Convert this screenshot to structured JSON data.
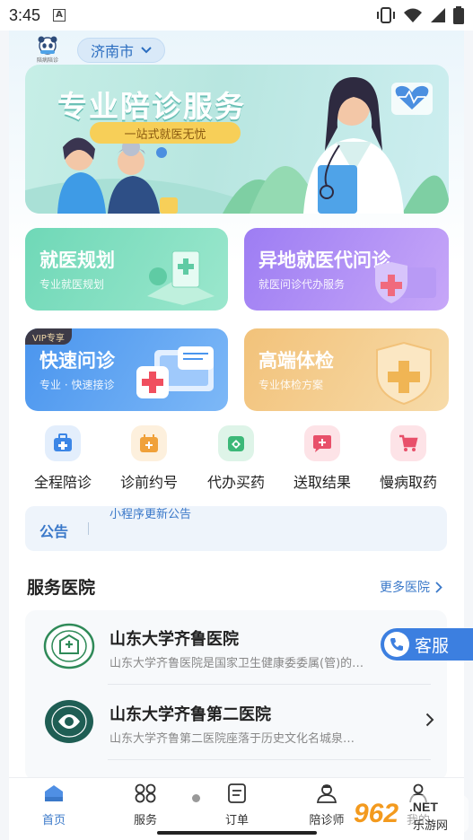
{
  "status_bar": {
    "time": "3:45",
    "a_badge": "A"
  },
  "header": {
    "logo_text": "陪病陪诊",
    "city": "济南市"
  },
  "banner": {
    "title": "专业陪诊服务",
    "subtitle": "一站式就医无忧"
  },
  "cards": [
    {
      "title": "就医规划",
      "subtitle": "专业就医规划"
    },
    {
      "title": "异地就医代问诊",
      "subtitle": "就医问诊代办服务"
    },
    {
      "title": "快速问诊",
      "subtitle": "专业 · 快速接诊",
      "badge": "VIP专享"
    },
    {
      "title": "高端体检",
      "subtitle": "专业体检方案"
    }
  ],
  "quick_actions": [
    {
      "label": "全程陪诊",
      "icon": "medical-kit-icon",
      "color": "#3c86e6"
    },
    {
      "label": "诊前约号",
      "icon": "calendar-plus-icon",
      "color": "#f0a13a"
    },
    {
      "label": "代办买药",
      "icon": "medicine-icon",
      "color": "#3cb878"
    },
    {
      "label": "送取结果",
      "icon": "report-icon",
      "color": "#e8506a"
    },
    {
      "label": "慢病取药",
      "icon": "cart-icon",
      "color": "#e8506a"
    }
  ],
  "notice": {
    "label": "公告",
    "text": "小程序更新公告"
  },
  "section": {
    "title": "服务医院",
    "more": "更多医院"
  },
  "hospitals": [
    {
      "name": "山东大学齐鲁医院",
      "desc": "山东大学齐鲁医院是国家卫生健康委委属(管)的…"
    },
    {
      "name": "山东大学齐鲁第二医院",
      "desc": "山东大学齐鲁第二医院座落于历史文化名城泉…"
    }
  ],
  "float_service": {
    "label": "客服"
  },
  "tabs": [
    {
      "label": "首页",
      "icon": "home-icon"
    },
    {
      "label": "服务",
      "icon": "grid-icon"
    },
    {
      "label": "订单",
      "icon": "order-icon"
    },
    {
      "label": "陪诊师",
      "icon": "nurse-icon"
    },
    {
      "label": "我的",
      "icon": "profile-icon"
    }
  ],
  "watermark": {
    "brand": "962",
    "suffix": ".NET",
    "caption": "乐游网"
  },
  "colors": {
    "accent": "#3a78c9",
    "brand": "#3c7fe0"
  }
}
